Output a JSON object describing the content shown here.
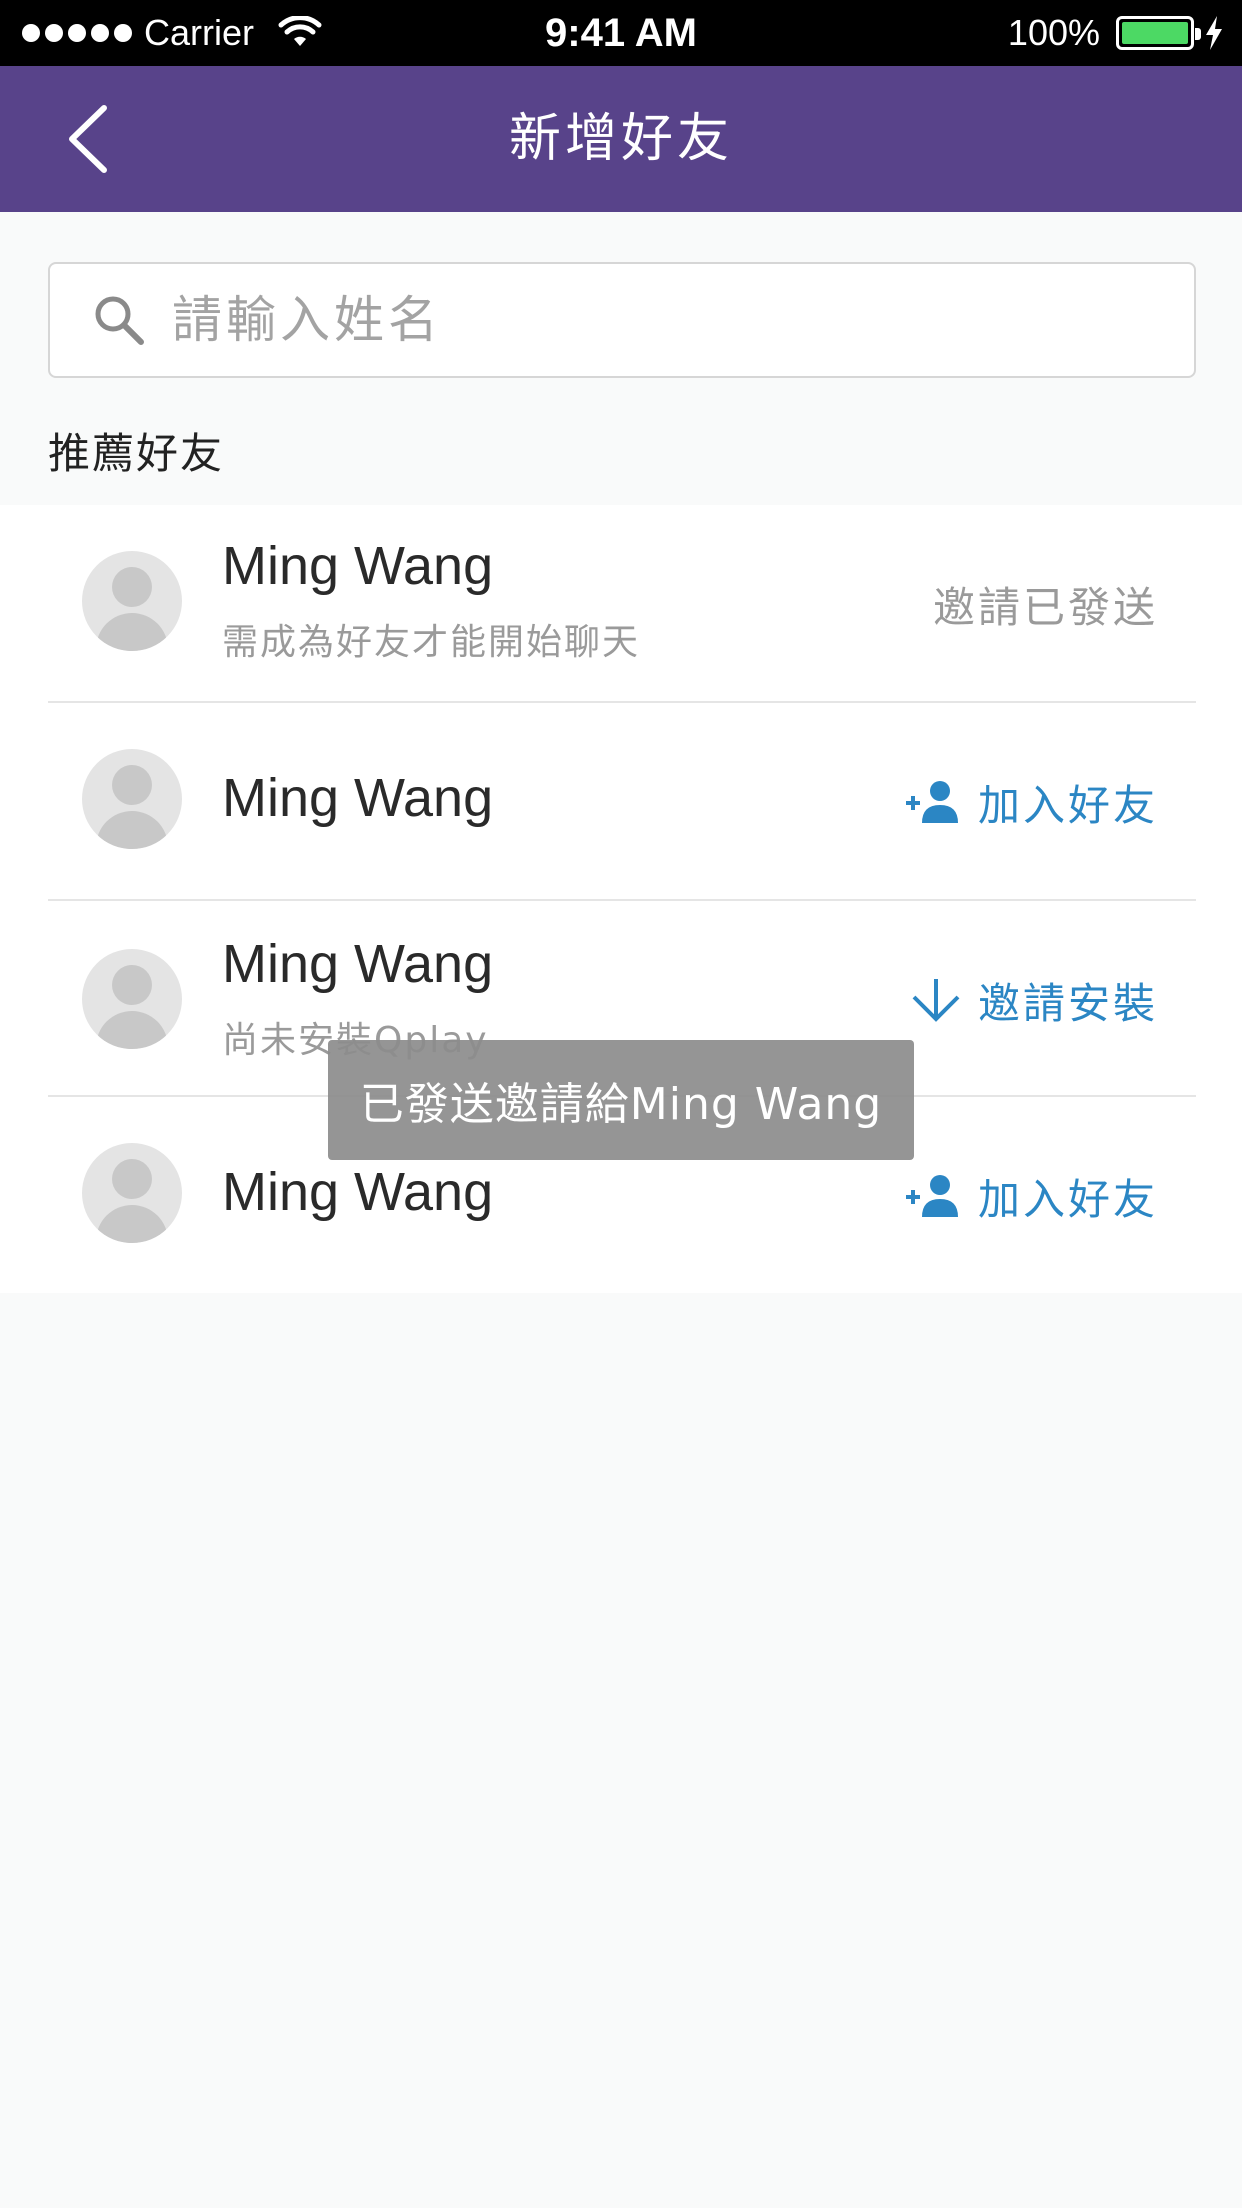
{
  "status_bar": {
    "carrier": "Carrier",
    "time": "9:41 AM",
    "battery": "100%"
  },
  "nav": {
    "title": "新增好友",
    "back_icon": "chevron-left-icon"
  },
  "search": {
    "placeholder": "請輸入姓名",
    "icon": "search-icon"
  },
  "section_title": "推薦好友",
  "friends": [
    {
      "name": "Ming Wang",
      "subtitle": "需成為好友才能開始聊天",
      "action": "邀請已發送",
      "action_type": "status"
    },
    {
      "name": "Ming Wang",
      "subtitle": "",
      "action": "加入好友",
      "action_type": "add-friend"
    },
    {
      "name": "Ming Wang",
      "subtitle": "尚未安裝Qplay",
      "action": "邀請安裝",
      "action_type": "invite-install"
    },
    {
      "name": "Ming Wang",
      "subtitle": "",
      "action": "加入好友",
      "action_type": "add-friend"
    }
  ],
  "toast": "已發送邀請給Ming Wang",
  "colors": {
    "nav_bg": "#58438a",
    "accent": "#2b86c4",
    "battery": "#4cd964"
  }
}
